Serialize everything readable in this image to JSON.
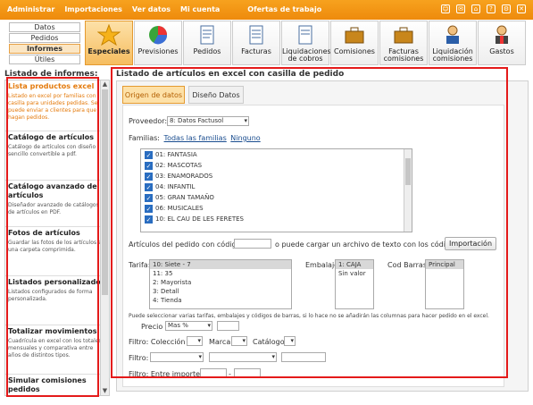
{
  "topmenu": [
    "Administrar",
    "Importaciones",
    "Ver datos",
    "Mi cuenta",
    "Ofertas de trabajo"
  ],
  "topicons": [
    "user-icon",
    "mail-icon",
    "home-icon",
    "help-icon",
    "settings-icon",
    "exit-icon"
  ],
  "submenu": [
    "Datos",
    "Pedidos",
    "Informes",
    "Útiles"
  ],
  "submenu_active": "Informes",
  "toolbar": [
    "Especiales",
    "Previsiones",
    "Pedidos",
    "Facturas",
    "Liquidaciones de cobros",
    "Comisiones",
    "Facturas comisiones",
    "Liquidación comisiones",
    "Gastos"
  ],
  "toolbar_active": "Especiales",
  "left": {
    "title": "Listado de informes:",
    "reports": [
      {
        "title": "Lista productos excel",
        "desc": "Listado en excel por familias con casilla para unidades pedidas. Se puede enviar a clientes para que hagan pedidos."
      },
      {
        "title": "Catálogo de artículos",
        "desc": "Catálogo de artículos con diseño sencillo convertible a pdf."
      },
      {
        "title": "Catálogo avanzado de artículos",
        "desc": "Diseñador avanzado de catálogos de artículos en PDF."
      },
      {
        "title": "Fotos de artículos",
        "desc": "Guardar las fotos de los artículos en una carpeta comprimida."
      },
      {
        "title": "Listados personalizados",
        "desc": "Listados configurados de forma personalizada."
      },
      {
        "title": "Totalizar movimientos",
        "desc": "Cuadrícula en excel con los totales mensuales y comparativa entre años de distintos tipos."
      },
      {
        "title": "Simular comisiones pedidos",
        "desc": ""
      }
    ]
  },
  "main": {
    "title": "Listado de artículos en excel con casilla de pedido",
    "tabs": [
      "Origen de datos",
      "Diseño Datos"
    ],
    "proveedor_label": "Proveedor:",
    "proveedor_value": "8: Datos Factusol",
    "familias_label": "Familias:",
    "todas_link": "Todas las familias",
    "ninguno_link": "Ninguno",
    "families": [
      "01: FANTASIA",
      "02: MASCOTAS",
      "03: ENAMORADOS",
      "04: INFANTIL",
      "05: GRAN TAMAÑO",
      "06: MUSICALES",
      "10: EL CAU DE LES FERETES"
    ],
    "articulos_label_1": "Artículos del pedido con código",
    "articulos_label_2": "o puede cargar un archivo de texto con los códigos:",
    "importacion_button": "Importación",
    "tarifa_label": "Tarifa:",
    "tarifas": [
      "10: Siete - 7",
      "11: 35",
      "2: Mayorista",
      "3: Detall",
      "4: Tienda"
    ],
    "embalaje_label": "Embalaje:",
    "embalajes": [
      "1: CAJA",
      "Sin valor"
    ],
    "codbarras_label": "Cod Barras:",
    "codbarras": [
      "Principal"
    ],
    "note": "Puede seleccionar varias tarifas, embalajes y códigos de barras, si lo hace no se añadirán las columnas para hacer pedido en el excel.",
    "precio_label": "Precio",
    "precio_value": "Mas %",
    "filtro_label": "Filtro:",
    "coleccion_label": "Colección",
    "marca_label": "Marca",
    "catalogo_label": "Catálogo",
    "filtro2_label": "Filtro:",
    "importes_label": "Filtro: Entre importes",
    "importes_dash": "-"
  },
  "colors": {
    "orange": "#f39c16",
    "red_box": "#e41a1a",
    "active_text": "#e47a0c",
    "check_blue": "#2a6dc0"
  }
}
